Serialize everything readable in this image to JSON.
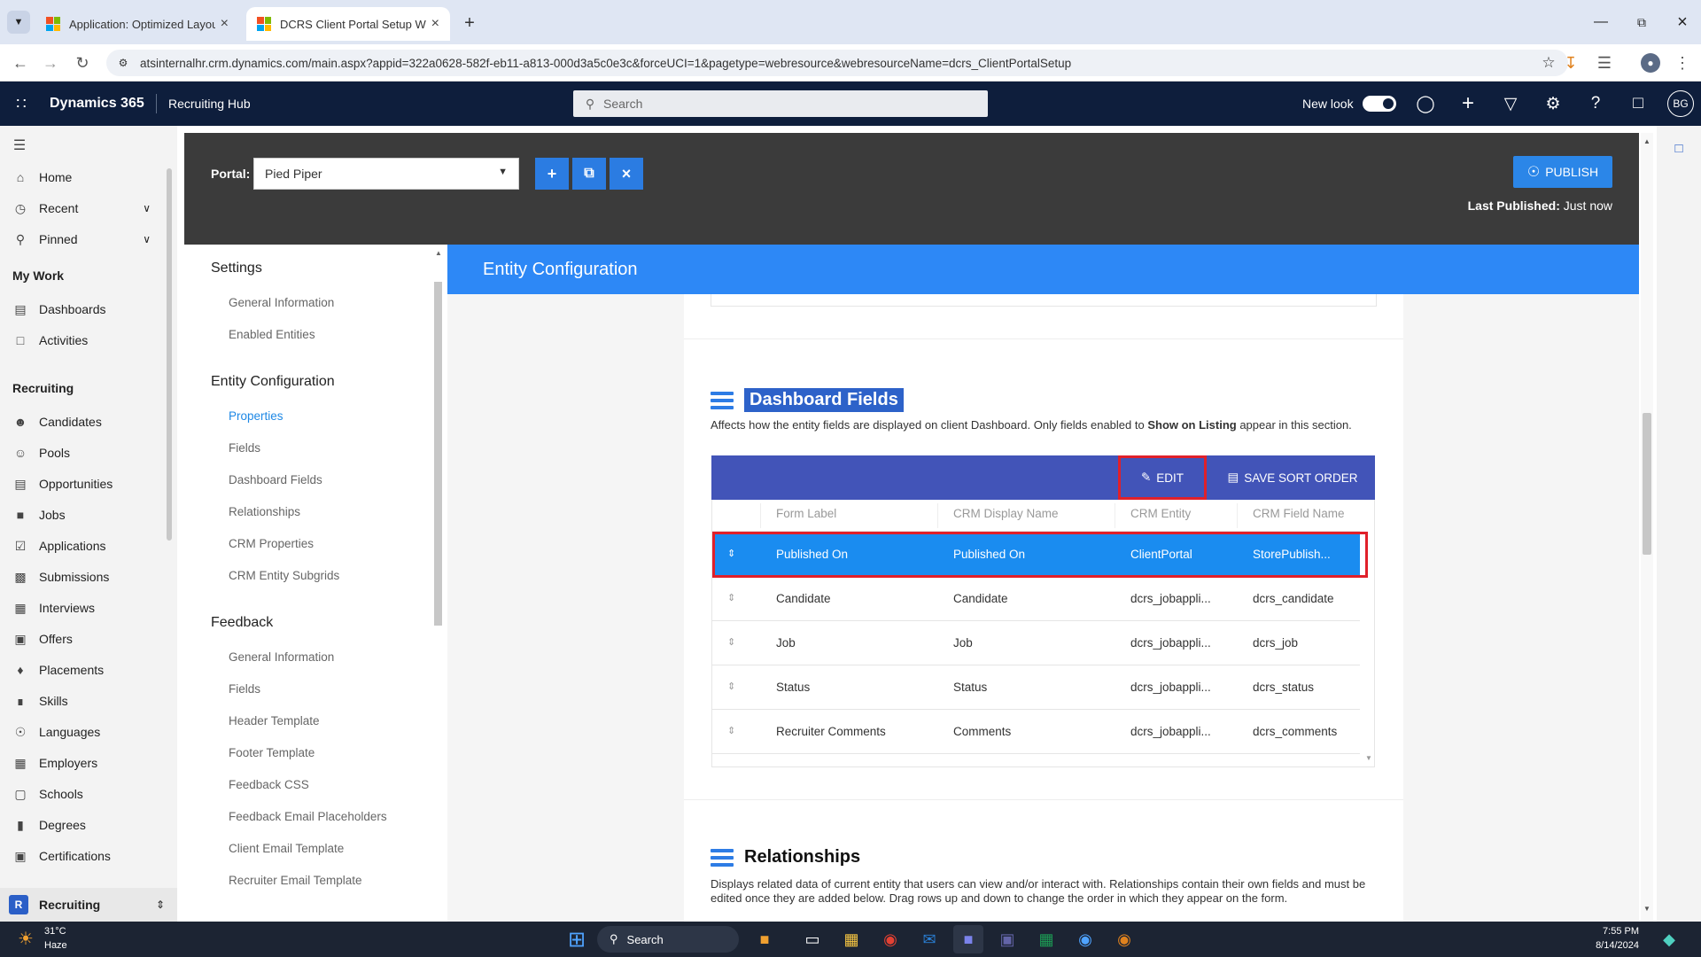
{
  "browser": {
    "tabs": [
      {
        "title": "Application: Optimized Layout"
      },
      {
        "title": "DCRS Client Portal Setup Web R"
      }
    ],
    "url": "atsinternalhr.crm.dynamics.com/main.aspx?appid=322a0628-582f-eb11-a813-000d3a5c0e3c&forceUCI=1&pagetype=webresource&webresourceName=dcrs_ClientPortalSetup"
  },
  "header": {
    "brand": "Dynamics 365",
    "app": "Recruiting Hub",
    "search_placeholder": "Search",
    "new_look_label": "New look",
    "avatar_initials": "BG"
  },
  "leftnav": {
    "top_items": [
      {
        "label": "Home",
        "icon": "home-icon"
      },
      {
        "label": "Recent",
        "icon": "clock-icon"
      },
      {
        "label": "Pinned",
        "icon": "pin-icon"
      }
    ],
    "my_work_title": "My Work",
    "my_work": [
      {
        "label": "Dashboards",
        "icon": "dashboard-icon"
      },
      {
        "label": "Activities",
        "icon": "activities-icon"
      }
    ],
    "recruiting_title": "Recruiting",
    "recruiting": [
      {
        "label": "Candidates",
        "icon": "person-icon"
      },
      {
        "label": "Pools",
        "icon": "people-icon"
      },
      {
        "label": "Opportunities",
        "icon": "document-icon"
      },
      {
        "label": "Jobs",
        "icon": "briefcase-icon"
      },
      {
        "label": "Applications",
        "icon": "check-doc-icon"
      },
      {
        "label": "Submissions",
        "icon": "inbox-icon"
      },
      {
        "label": "Interviews",
        "icon": "calendar-icon"
      },
      {
        "label": "Offers",
        "icon": "offer-icon"
      },
      {
        "label": "Placements",
        "icon": "placement-icon"
      },
      {
        "label": "Skills",
        "icon": "tools-icon"
      },
      {
        "label": "Languages",
        "icon": "globe-icon"
      },
      {
        "label": "Employers",
        "icon": "building-icon"
      },
      {
        "label": "Schools",
        "icon": "school-icon"
      },
      {
        "label": "Degrees",
        "icon": "book-icon"
      },
      {
        "label": "Certifications",
        "icon": "certificate-icon"
      }
    ],
    "area_switcher": {
      "initial": "R",
      "label": "Recruiting"
    }
  },
  "portal": {
    "label": "Portal:",
    "selected": "Pied Piper",
    "publish_label": "PUBLISH",
    "last_published_label": "Last Published:",
    "last_published_value": "Just now"
  },
  "settings_nav": {
    "groups": [
      {
        "title": "Settings",
        "links": [
          "General Information",
          "Enabled Entities"
        ]
      },
      {
        "title": "Entity Configuration",
        "links": [
          "Properties",
          "Fields",
          "Dashboard Fields",
          "Relationships",
          "CRM Properties",
          "CRM Entity Subgrids"
        ]
      },
      {
        "title": "Feedback",
        "links": [
          "General Information",
          "Fields",
          "Header Template",
          "Footer Template",
          "Feedback CSS",
          "Feedback Email Placeholders",
          "Client Email Template",
          "Recruiter Email Template"
        ]
      }
    ],
    "active_link": "Properties"
  },
  "entity_config": {
    "title": "Entity Configuration",
    "dashboard_fields": {
      "title": "Dashboard Fields",
      "description_part1": "Affects how the entity fields are displayed on client Dashboard. Only fields enabled to ",
      "description_bold": "Show on Listing",
      "description_part2": " appear in this section.",
      "edit_label": "EDIT",
      "save_sort_label": "SAVE SORT ORDER",
      "columns": [
        "Form Label",
        "CRM Display Name",
        "CRM Entity",
        "CRM Field Name"
      ],
      "rows": [
        [
          "Published On",
          "Published On",
          "ClientPortal",
          "StorePublish..."
        ],
        [
          "Candidate",
          "Candidate",
          "dcrs_jobappli...",
          "dcrs_candidate"
        ],
        [
          "Job",
          "Job",
          "dcrs_jobappli...",
          "dcrs_job"
        ],
        [
          "Status",
          "Status",
          "dcrs_jobappli...",
          "dcrs_status"
        ],
        [
          "Recruiter Comments",
          "Comments",
          "dcrs_jobappli...",
          "dcrs_comments"
        ]
      ]
    },
    "relationships": {
      "title": "Relationships",
      "description": "Displays related data of current entity that users can view and/or interact with. Relationships contain their own fields and must be edited once they are added below. Drag rows up and down to change the order in which they appear on the form."
    }
  },
  "taskbar": {
    "weather_temp": "31°C",
    "weather_desc": "Haze",
    "search_label": "Search",
    "time": "7:55 PM",
    "date": "8/14/2024"
  },
  "colors": {
    "accent": "#2d88f6",
    "grid_toolbar": "#4254b8",
    "selected_row": "#1a8cf0",
    "highlight_box": "#e0202a",
    "header_bg": "#0e1e3c"
  }
}
